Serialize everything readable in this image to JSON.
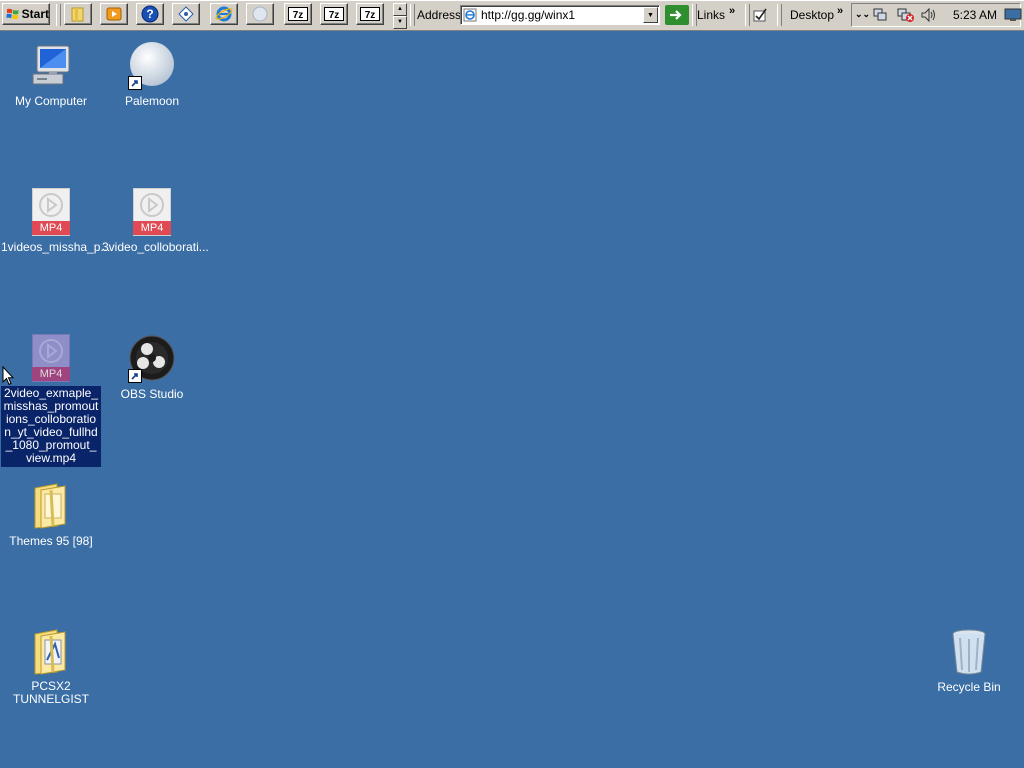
{
  "taskbar": {
    "start_label": "Start",
    "quick_launch": [
      {
        "icon": "folder-icon"
      },
      {
        "icon": "media-player-icon"
      },
      {
        "icon": "help-icon"
      },
      {
        "icon": "network-icon"
      },
      {
        "icon": "internet-explorer-icon"
      },
      {
        "icon": "palemoon-icon"
      },
      {
        "icon": "7zip-icon"
      },
      {
        "icon": "7zip-icon"
      },
      {
        "icon": "7zip-icon"
      }
    ],
    "address_label": "Address",
    "address_value": "http://gg.gg/winx1",
    "links_label": "Links",
    "desktop_label": "Desktop",
    "clock": "5:23 AM"
  },
  "desktop": {
    "icons": [
      {
        "label": "My Computer",
        "icon": "my-computer-icon"
      },
      {
        "label": "Palemoon",
        "icon": "palemoon-icon",
        "shortcut": true
      },
      {
        "label": "1videos_missha_p...",
        "icon": "mp4-file-icon",
        "badge": "MP4"
      },
      {
        "label": "3video_colloborati...",
        "icon": "mp4-file-icon",
        "badge": "MP4"
      },
      {
        "label": "2video_exmaple_misshas_promoutions_colloboration_yt_video_fullhd_1080_promout_view.mp4",
        "icon": "mp4-file-icon",
        "badge": "MP4",
        "selected": true
      },
      {
        "label": "OBS Studio",
        "icon": "obs-icon",
        "shortcut": true
      },
      {
        "label": "Themes 95 [98]",
        "icon": "folder-icon"
      },
      {
        "label": "PCSX2 TUNNELGIST",
        "icon": "folder-icon"
      },
      {
        "label": "Recycle Bin",
        "icon": "recycle-bin-icon"
      }
    ]
  },
  "colors": {
    "desktop_background": "#3a6ea5",
    "selection": "#0a246a",
    "taskbar": "#d4d0c8"
  }
}
